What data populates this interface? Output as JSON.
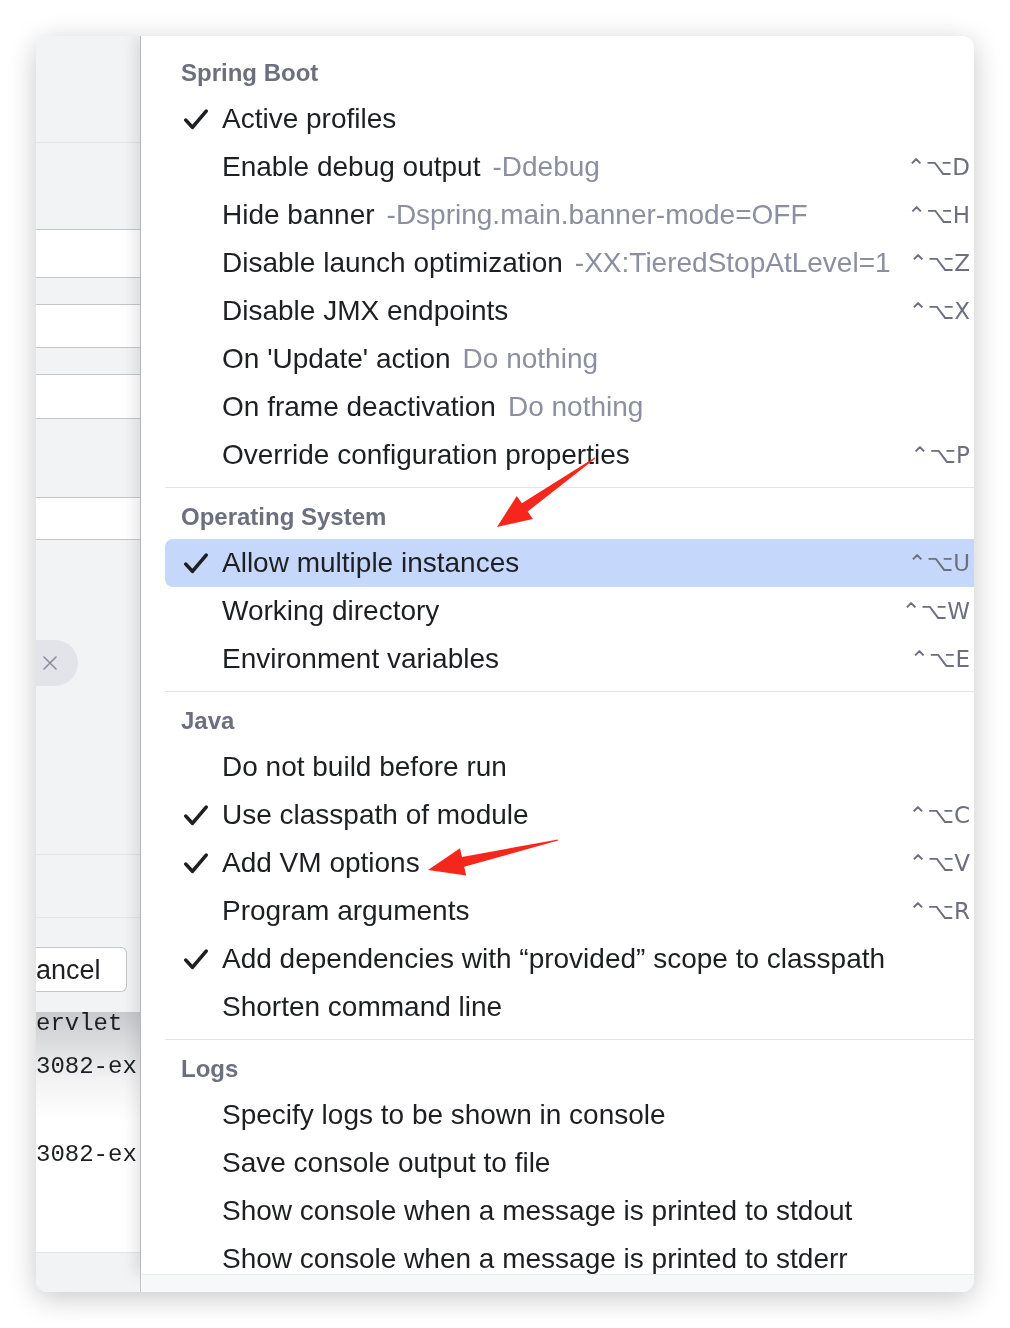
{
  "background_dialog": {
    "cancel_button": "ancel",
    "console_lines": [
      "ervlet",
      "3082-ex",
      "3082-ex"
    ]
  },
  "menu": {
    "sections": [
      {
        "title": "Spring Boot",
        "items": [
          {
            "label": "Active profiles",
            "checked": true,
            "selected": false
          },
          {
            "label": "Enable debug output",
            "hint": "-Ddebug",
            "shortcut": "⌃⌥D",
            "checked": false,
            "selected": false
          },
          {
            "label": "Hide banner",
            "hint": "-Dspring.main.banner-mode=OFF",
            "shortcut": "⌃⌥H",
            "checked": false,
            "selected": false
          },
          {
            "label": "Disable launch optimization",
            "hint": "-XX:TieredStopAtLevel=1",
            "shortcut": "⌃⌥Z",
            "checked": false,
            "selected": false
          },
          {
            "label": "Disable JMX endpoints",
            "shortcut": "⌃⌥X",
            "checked": false,
            "selected": false
          },
          {
            "label": "On 'Update' action",
            "hint": "Do nothing",
            "checked": false,
            "selected": false
          },
          {
            "label": "On frame deactivation",
            "hint": "Do nothing",
            "checked": false,
            "selected": false
          },
          {
            "label": "Override configuration properties",
            "shortcut": "⌃⌥P",
            "checked": false,
            "selected": false
          }
        ]
      },
      {
        "title": "Operating System",
        "items": [
          {
            "label": "Allow multiple instances",
            "shortcut": "⌃⌥U",
            "checked": true,
            "selected": true
          },
          {
            "label": "Working directory",
            "shortcut": "⌃⌥W",
            "checked": false,
            "selected": false
          },
          {
            "label": "Environment variables",
            "shortcut": "⌃⌥E",
            "checked": false,
            "selected": false
          }
        ]
      },
      {
        "title": "Java",
        "items": [
          {
            "label": "Do not build before run",
            "checked": false,
            "selected": false
          },
          {
            "label": "Use classpath of module",
            "shortcut": "⌃⌥C",
            "checked": true,
            "selected": false
          },
          {
            "label": "Add VM options",
            "shortcut": "⌃⌥V",
            "checked": true,
            "selected": false
          },
          {
            "label": "Program arguments",
            "shortcut": "⌃⌥R",
            "checked": false,
            "selected": false
          },
          {
            "label": "Add dependencies with “provided” scope to classpath",
            "checked": true,
            "selected": false
          },
          {
            "label": "Shorten command line",
            "checked": false,
            "selected": false
          }
        ]
      },
      {
        "title": "Logs",
        "items": [
          {
            "label": "Specify logs to be shown in console",
            "checked": false,
            "selected": false
          },
          {
            "label": "Save console output to file",
            "checked": false,
            "selected": false
          },
          {
            "label": "Show console when a message is printed to stdout",
            "checked": false,
            "selected": false
          },
          {
            "label": "Show console when a message is printed to stderr",
            "checked": false,
            "selected": false
          }
        ]
      }
    ]
  }
}
